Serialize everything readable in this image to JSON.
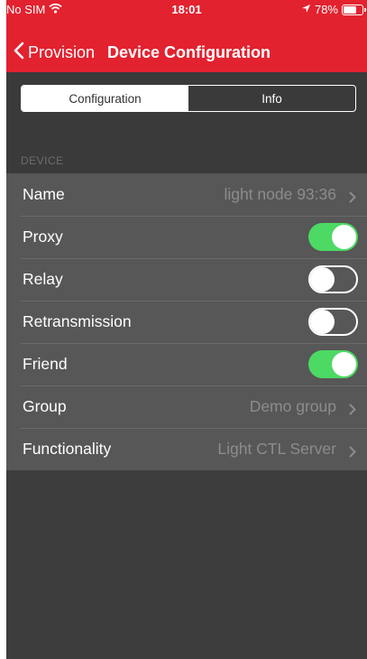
{
  "status_bar": {
    "carrier": "No SIM",
    "time": "18:01",
    "battery_text": "78%",
    "battery_level": 0.78,
    "icons": [
      "wifi-icon",
      "location-arrow-icon",
      "battery-icon"
    ]
  },
  "nav": {
    "back_label": "Provision",
    "title": "Device Configuration"
  },
  "segments": [
    {
      "label": "Configuration",
      "selected": true
    },
    {
      "label": "Info",
      "selected": false
    }
  ],
  "section_title": "DEVICE",
  "rows": [
    {
      "label": "Name",
      "value": "light node 93:36",
      "type": "disclosure"
    },
    {
      "label": "Proxy",
      "type": "toggle",
      "on": true
    },
    {
      "label": "Relay",
      "type": "toggle",
      "on": false
    },
    {
      "label": "Retransmission",
      "type": "toggle",
      "on": false
    },
    {
      "label": "Friend",
      "type": "toggle",
      "on": true
    },
    {
      "label": "Group",
      "value": "Demo group",
      "type": "disclosure"
    },
    {
      "label": "Functionality",
      "value": "Light CTL Server",
      "type": "disclosure"
    }
  ],
  "colors": {
    "accent": "#e2222f",
    "toggle_on": "#4cd964",
    "background": "#3d3d3d",
    "row": "#575757"
  }
}
